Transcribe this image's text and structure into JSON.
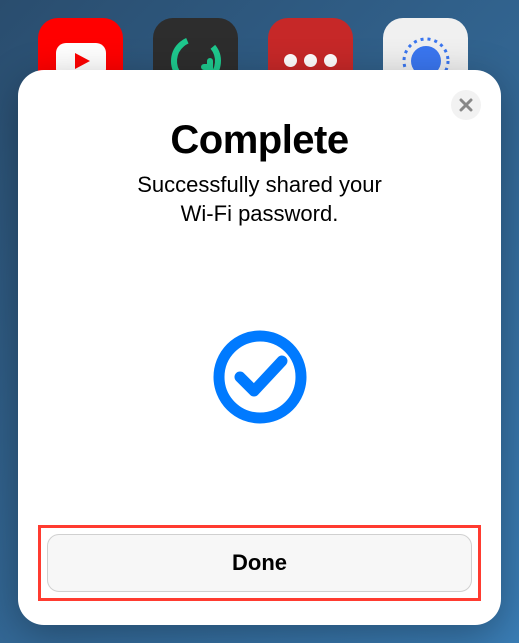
{
  "apps": [
    {
      "name": "youtube"
    },
    {
      "name": "grammarly"
    },
    {
      "name": "more"
    },
    {
      "name": "signal"
    }
  ],
  "modal": {
    "title": "Complete",
    "subtitle_line1": "Successfully shared your",
    "subtitle_line2": "Wi-Fi password.",
    "done_label": "Done"
  }
}
